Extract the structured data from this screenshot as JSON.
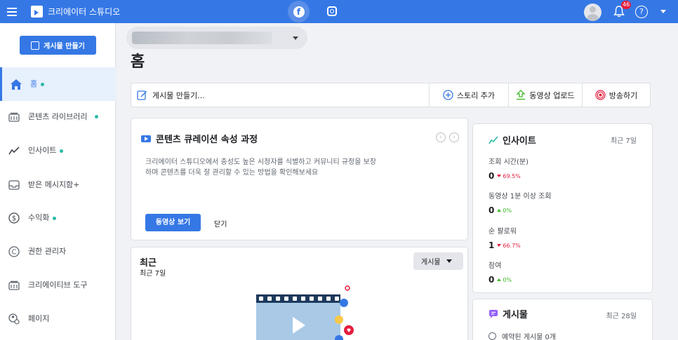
{
  "topbar": {
    "app_title": "크리에이터 스튜디오",
    "notification_count": "46",
    "help_label": "?",
    "facebook_label": "f"
  },
  "sidebar": {
    "create_button": "게시물 만들기",
    "items": [
      {
        "label": "홈",
        "icon": "home-icon",
        "dot": true,
        "active": true
      },
      {
        "label": "콘텐츠 라이브러리",
        "icon": "content-library-icon",
        "dot": true,
        "active": false
      },
      {
        "label": "인사이트",
        "icon": "insights-icon",
        "dot": true,
        "active": false
      },
      {
        "label": "받은 메시지함+",
        "icon": "inbox-icon",
        "dot": false,
        "active": false
      },
      {
        "label": "수익화",
        "icon": "dollar-icon",
        "dot": true,
        "active": false
      },
      {
        "label": "권한 관리자",
        "icon": "copyright-icon",
        "dot": false,
        "active": false
      },
      {
        "label": "크리에이티브 도구",
        "icon": "creative-tools-icon",
        "dot": false,
        "active": false
      },
      {
        "label": "페이지",
        "icon": "page-settings-icon",
        "dot": false,
        "active": false
      }
    ]
  },
  "main": {
    "title": "홈",
    "actions": {
      "compose": "게시물 만들기...",
      "story": "스토리 추가",
      "video": "동영상 업로드",
      "live": "방송하기"
    },
    "curation": {
      "title": "콘텐츠 큐레이션 속성 과정",
      "body": "크리에이터 스튜디오에서 충성도 높은 시청자를 식별하고 커뮤니티 규정을 보장하며 콘텐츠를 더욱 잘 관리할 수 있는 방법을 확인해보세요",
      "primary": "동영상 보기",
      "close": "닫기"
    },
    "recent": {
      "title": "최근",
      "period": "최근 7일",
      "filter": "게시물"
    }
  },
  "insights": {
    "title": "인사이트",
    "period": "최근 7일",
    "metrics": [
      {
        "label": "조회 시간(분)",
        "value": "0",
        "change": "69.5%",
        "direction": "down"
      },
      {
        "label": "동영상 1분 이상 조회",
        "value": "0",
        "change": "0%",
        "direction": "up"
      },
      {
        "label": "순 팔로워",
        "value": "1",
        "change": "66.7%",
        "direction": "down"
      },
      {
        "label": "참여",
        "value": "0",
        "change": "0%",
        "direction": "up"
      }
    ]
  },
  "posts": {
    "title": "게시물",
    "period": "최근 28일",
    "scheduled": "예약된 게시물 0개"
  },
  "colors": {
    "brand": "#3578e5",
    "positive": "#42b72a",
    "negative": "#e41e3f",
    "dot": "#2abba7"
  }
}
